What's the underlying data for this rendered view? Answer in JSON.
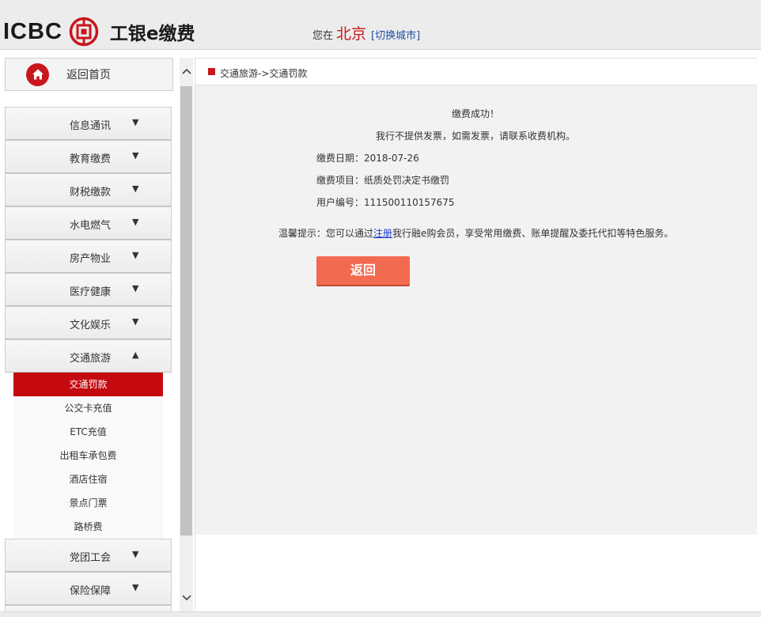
{
  "header": {
    "logo_text": "ICBC",
    "brand_name": "工银e缴费",
    "city_prefix": "您在",
    "city_name": "北京",
    "city_switch": "[切换城市]"
  },
  "sidebar": {
    "home_label": "返回首页",
    "categories_top": [
      {
        "label": "信息通讯",
        "arrow": "▼"
      },
      {
        "label": "教育缴费",
        "arrow": "▼"
      },
      {
        "label": "财税缴款",
        "arrow": "▼"
      },
      {
        "label": "水电燃气",
        "arrow": "▼"
      },
      {
        "label": "房产物业",
        "arrow": "▼"
      },
      {
        "label": "医疗健康",
        "arrow": "▼"
      },
      {
        "label": "文化娱乐",
        "arrow": "▼"
      },
      {
        "label": "交通旅游",
        "arrow": "▲"
      }
    ],
    "sub_items": [
      {
        "label": "交通罚款",
        "active": true
      },
      {
        "label": "公交卡充值"
      },
      {
        "label": "ETC充值"
      },
      {
        "label": "出租车承包费"
      },
      {
        "label": "酒店住宿"
      },
      {
        "label": "景点门票"
      },
      {
        "label": "路桥费"
      }
    ],
    "categories_bottom": [
      {
        "label": "党团工会",
        "arrow": "▼"
      },
      {
        "label": "保险保障",
        "arrow": "▼"
      }
    ]
  },
  "content": {
    "breadcrumb": "交通旅游->交通罚款",
    "success_title": "缴费成功！",
    "invoice_note": "我行不提供发票，如需发票，请联系收费机构。",
    "date_line": "缴费日期：2018-07-26",
    "item_line": "缴费项目：纸质处罚决定书缴罚",
    "user_line": "用户编号：111500110157675",
    "tip_prefix": "温馨提示：您可以通过",
    "tip_link": "注册",
    "tip_suffix": "我行融e购会员，享受常用缴费、账单提醒及委托代扣等特色服务。",
    "back_button": "返回"
  },
  "colors": {
    "brand_red": "#c8161d",
    "button_orange": "#f26b50",
    "link_blue": "#1e4fa3"
  }
}
